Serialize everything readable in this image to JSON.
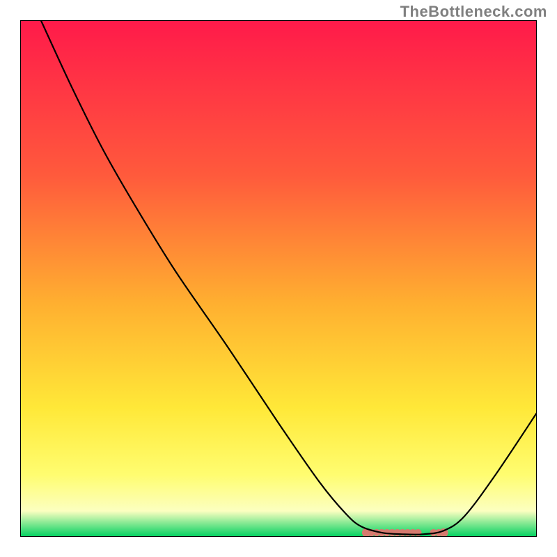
{
  "attribution": "TheBottleneck.com",
  "chart_data": {
    "type": "line",
    "title": "",
    "xlabel": "",
    "ylabel": "",
    "xlim": [
      0,
      100
    ],
    "ylim": [
      0,
      100
    ],
    "grid": false,
    "legend": false,
    "gradient_stops": [
      {
        "offset": 0,
        "color": "#ff1a4a"
      },
      {
        "offset": 30,
        "color": "#ff5a3c"
      },
      {
        "offset": 55,
        "color": "#ffb030"
      },
      {
        "offset": 75,
        "color": "#ffe838"
      },
      {
        "offset": 88,
        "color": "#fffd70"
      },
      {
        "offset": 95,
        "color": "#fcffc0"
      },
      {
        "offset": 100,
        "color": "#00d060"
      }
    ],
    "curve_points": [
      {
        "x": 4.0,
        "y": 100.0
      },
      {
        "x": 10.0,
        "y": 87.0
      },
      {
        "x": 16.0,
        "y": 75.0
      },
      {
        "x": 22.0,
        "y": 64.5
      },
      {
        "x": 30.0,
        "y": 51.5
      },
      {
        "x": 40.0,
        "y": 37.0
      },
      {
        "x": 50.0,
        "y": 22.0
      },
      {
        "x": 58.0,
        "y": 10.5
      },
      {
        "x": 63.0,
        "y": 4.5
      },
      {
        "x": 66.0,
        "y": 2.0
      },
      {
        "x": 70.0,
        "y": 0.8
      },
      {
        "x": 74.0,
        "y": 0.5
      },
      {
        "x": 78.0,
        "y": 0.5
      },
      {
        "x": 82.0,
        "y": 1.2
      },
      {
        "x": 86.0,
        "y": 4.0
      },
      {
        "x": 92.0,
        "y": 12.0
      },
      {
        "x": 100.0,
        "y": 24.0
      }
    ],
    "marker_band": {
      "x_start": 67.0,
      "x_end": 82.0,
      "y": 0.8,
      "color": "#d67a6f",
      "gap_at_x": 78.5
    },
    "colors": {
      "curve": "#000000",
      "frame": "#000000",
      "background": "#ffffff"
    }
  }
}
